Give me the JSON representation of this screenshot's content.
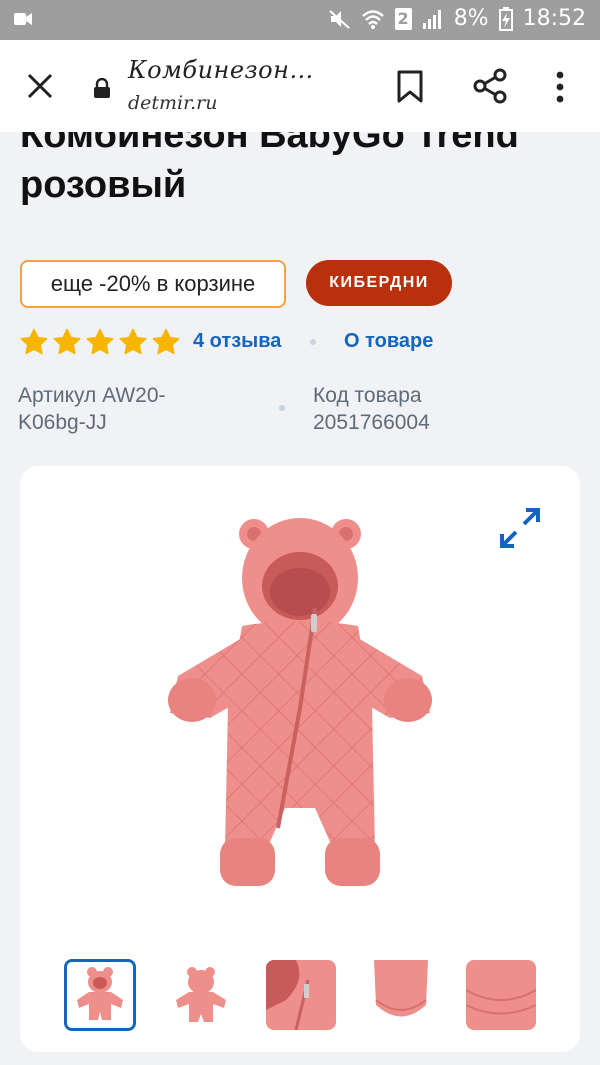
{
  "status_bar": {
    "sim_slot": "2",
    "battery": "8%",
    "time": "18:52"
  },
  "browser": {
    "page_title": "Комбинезон…",
    "url": "detmir.ru"
  },
  "product": {
    "title": "Комбинезон BabyGo Trend розовый",
    "promo_label": "еще -20% в корзине",
    "cyber_badge": "КИБЕРДНИ",
    "rating_stars": 5,
    "reviews_link": "4 отзыва",
    "about_link": "О товаре",
    "article_label": "Артикул AW20-K06bg-JJ",
    "code_label": "Код товара 2051766004"
  },
  "gallery": {
    "thumbnails_count": 5,
    "selected_index": 0
  },
  "colors": {
    "accent_blue": "#1565c0",
    "promo_border": "#f5a142",
    "cyber_red": "#b8300c",
    "star_yellow": "#f7b500",
    "product_pink": "#ee8f8c"
  }
}
